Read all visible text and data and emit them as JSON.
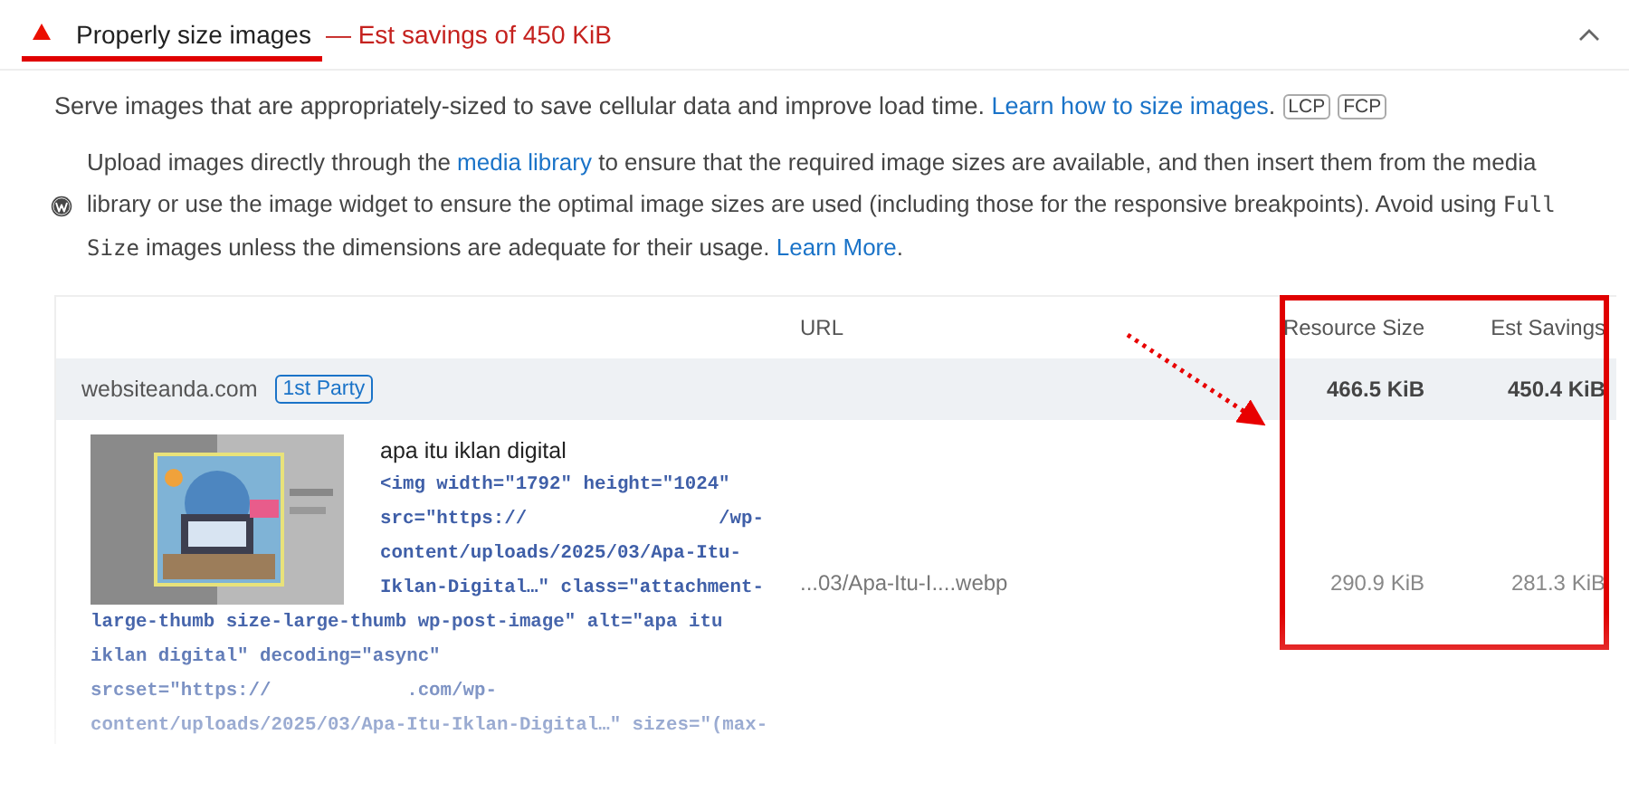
{
  "audit": {
    "title": "Properly size images",
    "savings": "— Est savings of 450 KiB",
    "expanded": true,
    "description": {
      "text": "Serve images that are appropriately-sized to save cellular data and improve load time. ",
      "link": "Learn how to size images",
      "end": "."
    },
    "tags": [
      "LCP",
      "FCP"
    ]
  },
  "stack_pack": {
    "segments": [
      {
        "kind": "text",
        "text": "Upload images directly through the "
      },
      {
        "kind": "link",
        "text": "media library"
      },
      {
        "kind": "text",
        "text": " to ensure that the required image sizes are available, and then insert them from the media library or use the image widget to ensure the optimal image sizes are used (including those for the responsive breakpoints). Avoid using "
      },
      {
        "kind": "code",
        "text": "Full Size"
      },
      {
        "kind": "text",
        "text": " images unless the dimensions are adequate for their usage. "
      },
      {
        "kind": "link",
        "text": "Learn More"
      },
      {
        "kind": "text",
        "text": "."
      }
    ]
  },
  "table": {
    "columns": [
      "URL",
      "Resource Size",
      "Est Savings"
    ],
    "groups": [
      {
        "entity": "websiteanda.com",
        "badge": "1st Party",
        "resource_size": "466.5 KiB",
        "est_savings": "450.4 KiB",
        "items": [
          {
            "node_label": "apa itu iklan digital",
            "snippet_lines": [
              "<img width=\"1792\" height=\"1024\"",
              "src=\"https://                 /wp-",
              "content/uploads/2025/03/Apa-Itu-",
              "Iklan-Digital…\" class=\"attachment-",
              "large-thumb size-large-thumb wp-post-image\" alt=\"apa itu",
              "iklan digital\" decoding=\"async\"",
              "srcset=\"https://            .com/wp-",
              "content/uploads/2025/03/Apa-Itu-Iklan-Digital…\" sizes=\"(max-"
            ],
            "url": "...03/Apa-Itu-I....webp",
            "resource_size": "290.9 KiB",
            "est_savings": "281.3 KiB"
          }
        ]
      }
    ]
  }
}
